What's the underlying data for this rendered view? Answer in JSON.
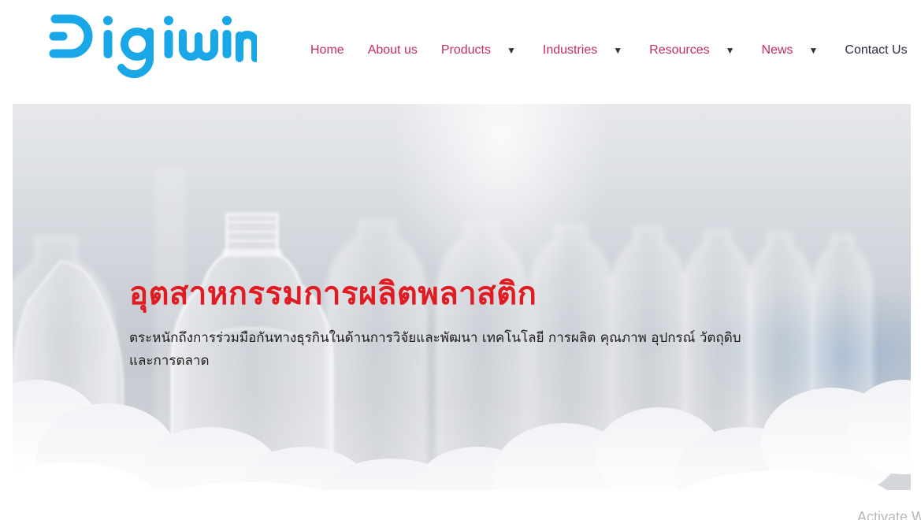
{
  "header": {
    "logo_text": "Digiwin",
    "nav": [
      {
        "label": "Home",
        "has_dropdown": false
      },
      {
        "label": "About us",
        "has_dropdown": false
      },
      {
        "label": "Products",
        "has_dropdown": true
      },
      {
        "label": "Industries",
        "has_dropdown": true
      },
      {
        "label": "Resources",
        "has_dropdown": true
      },
      {
        "label": "News",
        "has_dropdown": true
      },
      {
        "label": "Contact Us",
        "has_dropdown": false
      }
    ],
    "caret_glyph": "▼"
  },
  "hero": {
    "title": "อุตสาหกรรมการผลิตพลาสติก",
    "description": "ตระหนักถึงการร่วมมือกันทางธุรกินในด้านการวิจัยและพัฒนา เทคโนโลยี การผลิต คุณภาพ อุปกรณ์ วัตถุดิบ และการตลาด"
  },
  "watermark": "Activate W",
  "colors": {
    "brand_blue": "#1aa7e8",
    "nav_text": "#c42d5c",
    "contact_text": "#2a2d40",
    "hero_title": "#e11b22"
  }
}
